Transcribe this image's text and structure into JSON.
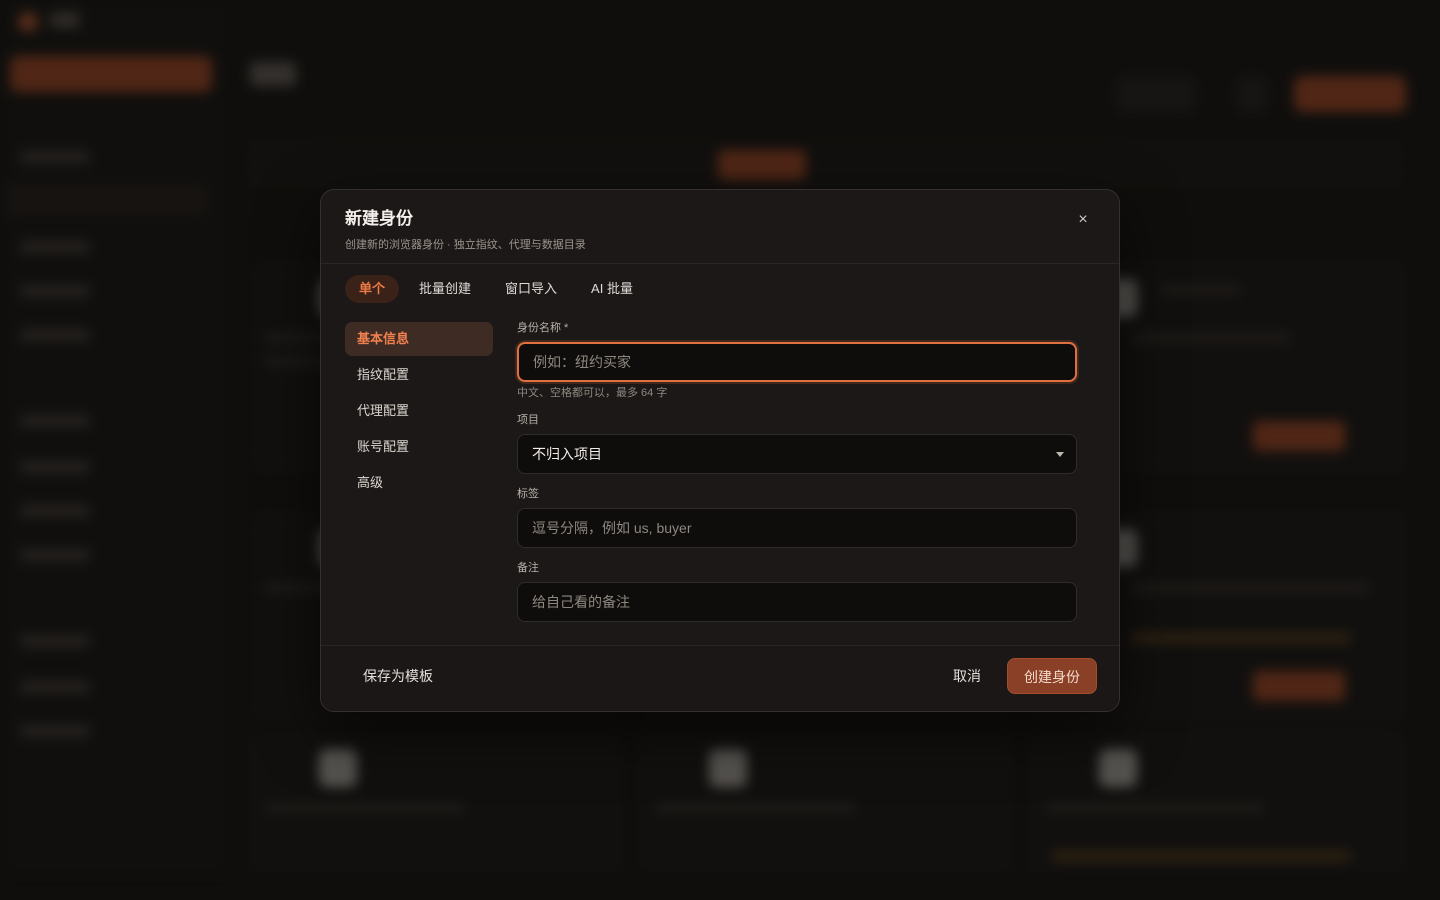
{
  "modal": {
    "title": "新建身份",
    "subtitle": "创建新的浏览器身份 · 独立指纹、代理与数据目录",
    "close_icon": "×"
  },
  "tabs": [
    {
      "label": "单个",
      "active": true
    },
    {
      "label": "批量创建",
      "active": false
    },
    {
      "label": "窗口导入",
      "active": false
    },
    {
      "label": "AI 批量",
      "active": false
    }
  ],
  "sections": [
    {
      "label": "基本信息",
      "active": true
    },
    {
      "label": "指纹配置",
      "active": false
    },
    {
      "label": "代理配置",
      "active": false
    },
    {
      "label": "账号配置",
      "active": false
    },
    {
      "label": "高级",
      "active": false
    }
  ],
  "form": {
    "name": {
      "label": "身份名称 *",
      "placeholder": "例如：纽约买家",
      "value": "",
      "hint": "中文、空格都可以，最多 64 字"
    },
    "project": {
      "label": "项目",
      "value": "不归入项目"
    },
    "tags": {
      "label": "标签",
      "placeholder": "逗号分隔，例如 us, buyer",
      "value": ""
    },
    "notes": {
      "label": "备注",
      "placeholder": "给自己看的备注",
      "value": ""
    }
  },
  "footer": {
    "save_template": "保存为模板",
    "cancel": "取消",
    "create": "创建身份"
  },
  "colors": {
    "accent": "#e0703f",
    "modal_bg": "#1b1817",
    "page_bg": "#141211"
  }
}
